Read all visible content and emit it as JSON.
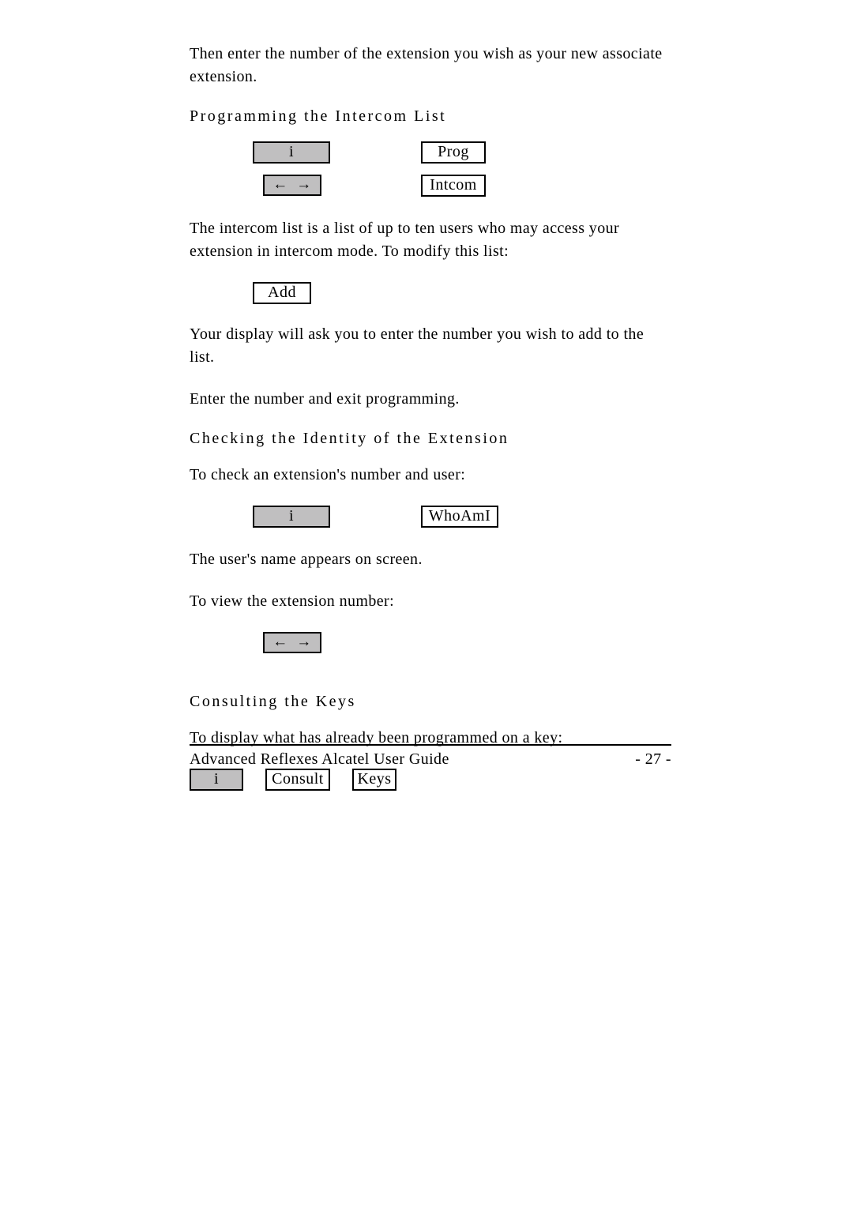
{
  "p1": "Then enter the number of the extension you wish as your new associate extension.",
  "h1": "Programming the Intercom List",
  "keys": {
    "i": "i",
    "prog": "Prog",
    "arrows": "←  →",
    "intcom": "Intcom",
    "add": "Add",
    "whoami": "WhoAmI",
    "consult": "Consult",
    "keys": "Keys"
  },
  "p2": "The intercom list is a list of up to ten users who may access your extension in intercom mode.  To modify this list:",
  "p3": "Your display will ask you to enter the number you wish to add to the list.",
  "p4": "Enter the number and exit programming.",
  "h2": "Checking the Identity of the Extension",
  "p5": "To check an extension's number and user:",
  "p6": "The user's name appears on screen.",
  "p7": "To view the extension number:",
  "h3": "Consulting the Keys",
  "p8": "To display what has already been programmed on a key:",
  "footer": {
    "title": "Advanced Reflexes Alcatel User Guide",
    "page": "- 27 -"
  }
}
